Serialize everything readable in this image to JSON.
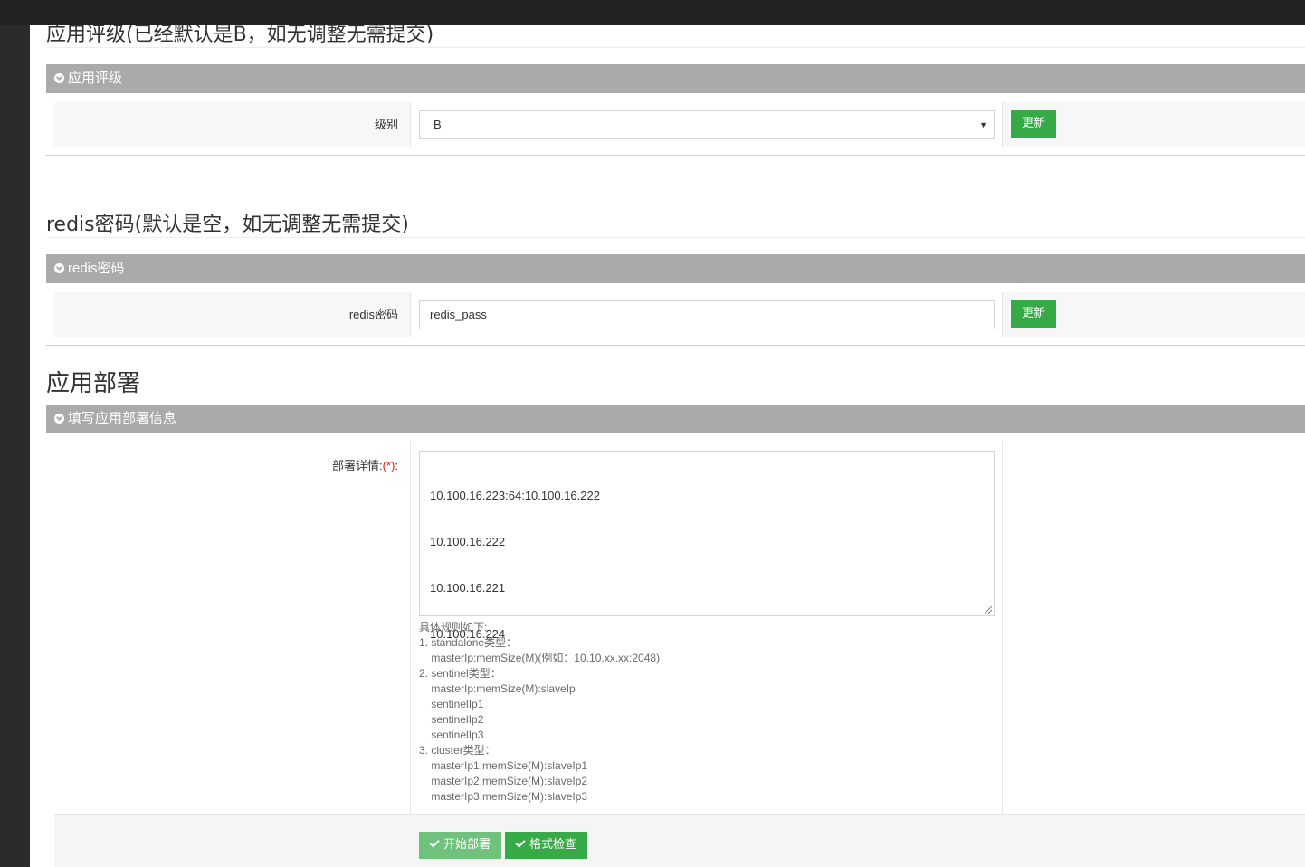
{
  "rating_section": {
    "title": "应用评级(已经默认是B，如无调整无需提交)",
    "panel_title": "应用评级",
    "label": "级别",
    "selected": "B",
    "button": "更新"
  },
  "redis_section": {
    "title": "redis密码(默认是空，如无调整无需提交)",
    "panel_title": "redis密码",
    "label": "redis密码",
    "value": "redis_pass",
    "button": "更新"
  },
  "deploy_section": {
    "title": "应用部署",
    "panel_title": "填写应用部署信息",
    "label": "部署详情:",
    "required_mark": "(*)",
    "label_suffix": ":",
    "textarea_lines": [
      "10.100.16.223:64:10.100.16.222",
      "10.100.16.222",
      "10.100.16.221",
      "10.100.16.224"
    ],
    "help_lines": [
      "具体规则如下:",
      "1. standalone类型：",
      "    masterIp:memSize(M)(例如：10.10.xx.xx:2048)",
      "2. sentinel类型：",
      "    masterIp:memSize(M):slaveIp",
      "    sentinelIp1",
      "    sentinelIp2",
      "    sentinelIp3",
      "3. cluster类型：",
      "    masterIp1:memSize(M):slaveIp1",
      "    masterIp2:memSize(M):slaveIp2",
      "    masterIp3:memSize(M):slaveIp3"
    ],
    "buttons": {
      "start": "开始部署",
      "check": "格式检查"
    }
  },
  "colors": {
    "panel_header": "#aaaaaa",
    "button_green": "#35aa47",
    "topbar": "#222222",
    "sidebar": "#2b2b2b"
  }
}
